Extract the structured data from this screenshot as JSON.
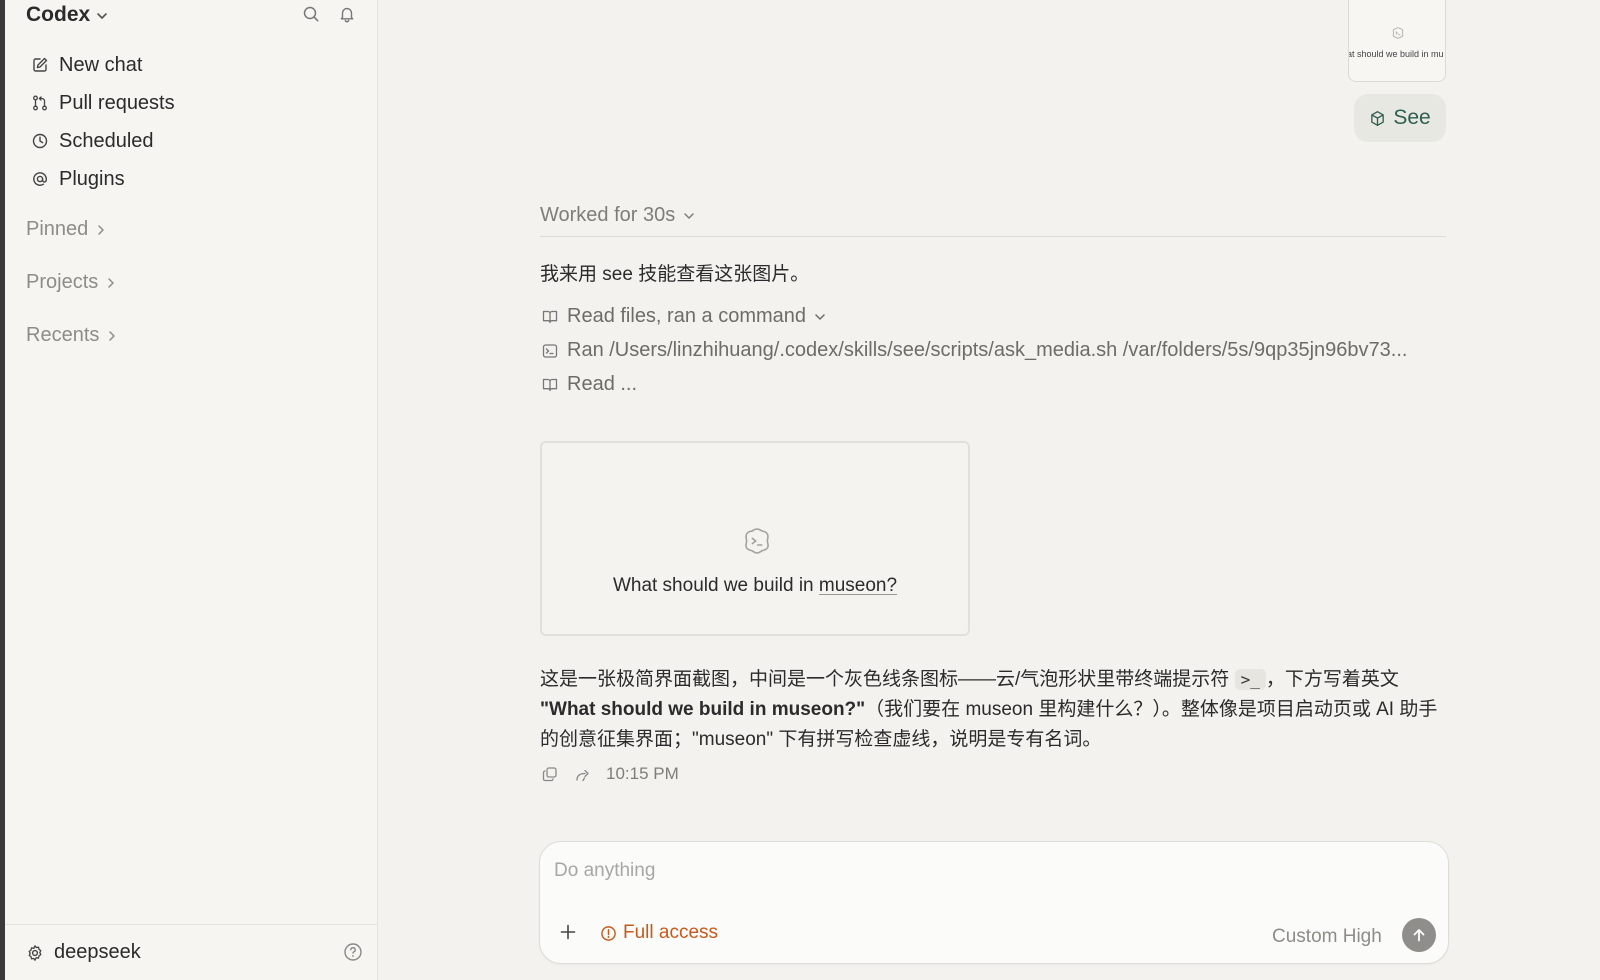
{
  "sidebar": {
    "brand": "Codex",
    "nav": [
      {
        "label": "New chat",
        "icon": "edit-icon"
      },
      {
        "label": "Pull requests",
        "icon": "pull-request-icon"
      },
      {
        "label": "Scheduled",
        "icon": "clock-icon"
      },
      {
        "label": "Plugins",
        "icon": "at-sign-icon"
      }
    ],
    "sections": {
      "pinned": "Pinned",
      "projects": "Projects",
      "recents": "Recents"
    },
    "footer": {
      "account": "deepseek"
    }
  },
  "main": {
    "attachment": {
      "thumb_text": "at should we build in mu",
      "chip_label": "See"
    },
    "worked_label": "Worked for 30s",
    "intro": "我来用 see 技能查看这张图片。",
    "steps": {
      "summary": "Read files, ran a command",
      "ran": "Ran /Users/linzhihuang/.codex/skills/see/scripts/ask_media.sh /var/folders/5s/9qp35jn96bv73...",
      "read": "Read ..."
    },
    "preview": {
      "text_before": "What should we build in ",
      "text_word": "museon?"
    },
    "answer": {
      "p1": "这是一张极简界面截图，中间是一个灰色线条图标——云/气泡形状里带终端提示符 ",
      "code": ">_",
      "p2": "，下方写着英文 ",
      "bold": "\"What should we build in museon?\"",
      "p3": "（我们要在 museon 里构建什么？）。整体像是项目启动页或 AI 助手的创意征集界面；\"museon\" 下有拼写检查虚线，说明是专有名词。"
    },
    "time": "10:15 PM"
  },
  "composer": {
    "placeholder": "Do anything",
    "access_label": "Full access",
    "model_label": "Custom  High"
  },
  "colors": {
    "background": "#f3f2ee",
    "sidebar": "#f6f5f1",
    "accent_warning": "#c65a1c",
    "see_chip_text": "#2f5f4f",
    "send_button": "#8f8e8a"
  }
}
